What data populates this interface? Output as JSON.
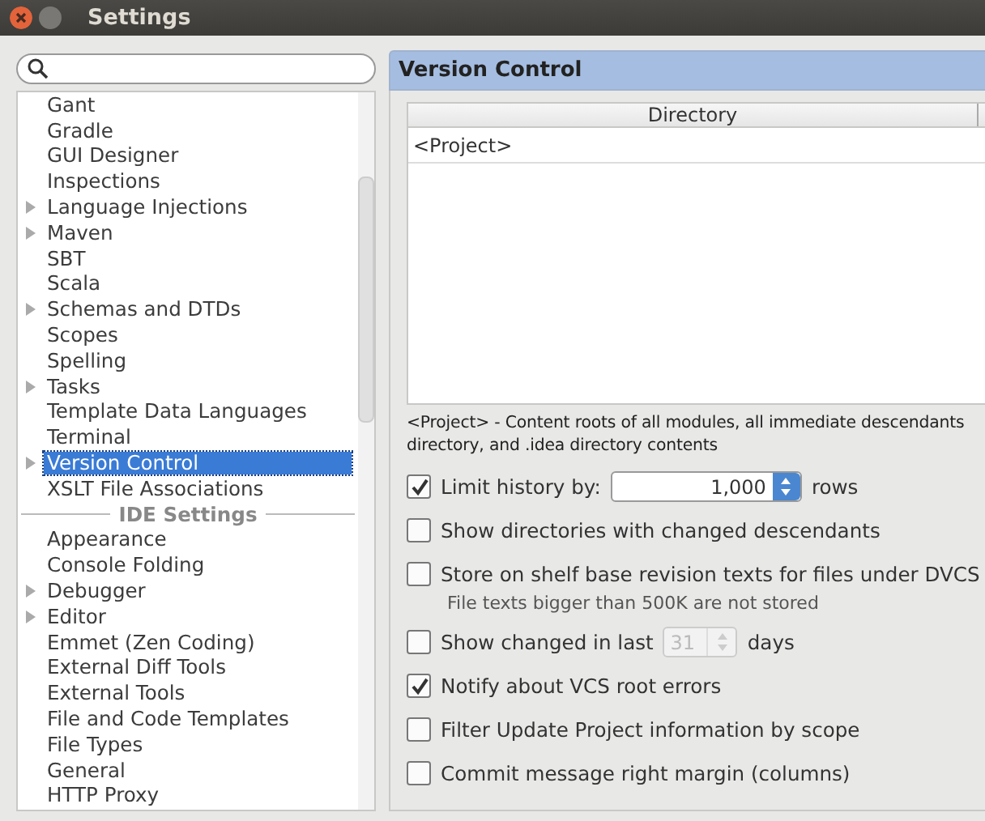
{
  "window": {
    "title": "Settings"
  },
  "sidebar": {
    "items": [
      {
        "kind": "item",
        "label": "Gant",
        "expandable": false,
        "selected": false
      },
      {
        "kind": "item",
        "label": "Gradle",
        "expandable": false,
        "selected": false
      },
      {
        "kind": "item",
        "label": "GUI Designer",
        "expandable": false,
        "selected": false
      },
      {
        "kind": "item",
        "label": "Inspections",
        "expandable": false,
        "selected": false
      },
      {
        "kind": "item",
        "label": "Language Injections",
        "expandable": true,
        "selected": false
      },
      {
        "kind": "item",
        "label": "Maven",
        "expandable": true,
        "selected": false
      },
      {
        "kind": "item",
        "label": "SBT",
        "expandable": false,
        "selected": false
      },
      {
        "kind": "item",
        "label": "Scala",
        "expandable": false,
        "selected": false
      },
      {
        "kind": "item",
        "label": "Schemas and DTDs",
        "expandable": true,
        "selected": false
      },
      {
        "kind": "item",
        "label": "Scopes",
        "expandable": false,
        "selected": false
      },
      {
        "kind": "item",
        "label": "Spelling",
        "expandable": false,
        "selected": false
      },
      {
        "kind": "item",
        "label": "Tasks",
        "expandable": true,
        "selected": false
      },
      {
        "kind": "item",
        "label": "Template Data Languages",
        "expandable": false,
        "selected": false
      },
      {
        "kind": "item",
        "label": "Terminal",
        "expandable": false,
        "selected": false
      },
      {
        "kind": "item",
        "label": "Version Control",
        "expandable": true,
        "selected": true
      },
      {
        "kind": "item",
        "label": "XSLT File Associations",
        "expandable": false,
        "selected": false
      },
      {
        "kind": "section",
        "label": "IDE Settings"
      },
      {
        "kind": "item",
        "label": "Appearance",
        "expandable": false,
        "selected": false
      },
      {
        "kind": "item",
        "label": "Console Folding",
        "expandable": false,
        "selected": false
      },
      {
        "kind": "item",
        "label": "Debugger",
        "expandable": true,
        "selected": false
      },
      {
        "kind": "item",
        "label": "Editor",
        "expandable": true,
        "selected": false
      },
      {
        "kind": "item",
        "label": "Emmet (Zen Coding)",
        "expandable": false,
        "selected": false
      },
      {
        "kind": "item",
        "label": "External Diff Tools",
        "expandable": false,
        "selected": false
      },
      {
        "kind": "item",
        "label": "External Tools",
        "expandable": false,
        "selected": false
      },
      {
        "kind": "item",
        "label": "File and Code Templates",
        "expandable": false,
        "selected": false
      },
      {
        "kind": "item",
        "label": "File Types",
        "expandable": false,
        "selected": false
      },
      {
        "kind": "item",
        "label": "General",
        "expandable": false,
        "selected": false
      },
      {
        "kind": "item",
        "label": "HTTP Proxy",
        "expandable": false,
        "selected": false
      }
    ]
  },
  "panel": {
    "title": "Version Control",
    "table": {
      "columns": [
        "Directory"
      ],
      "rows": [
        [
          "<Project>"
        ]
      ]
    },
    "description": [
      "<Project> - Content roots of all modules, all immediate descendants",
      "directory, and .idea directory contents"
    ],
    "options": [
      {
        "kind": "spinner",
        "label": "Limit history by:",
        "checked": true,
        "value": "1,000",
        "suffix": "rows",
        "disabled": false
      },
      {
        "kind": "check",
        "label": "Show directories with changed descendants",
        "checked": false
      },
      {
        "kind": "check",
        "label": "Store on shelf base revision texts for files under DVCS",
        "checked": false,
        "note": "File texts bigger than 500K are not stored"
      },
      {
        "kind": "spinner",
        "label": "Show changed in last",
        "checked": false,
        "value": "31",
        "suffix": "days",
        "disabled": true
      },
      {
        "kind": "check",
        "label": "Notify about VCS root errors",
        "checked": true
      },
      {
        "kind": "check",
        "label": "Filter Update Project information by scope",
        "checked": false
      },
      {
        "kind": "check",
        "label": "Commit message right margin (columns)",
        "checked": false
      }
    ]
  }
}
